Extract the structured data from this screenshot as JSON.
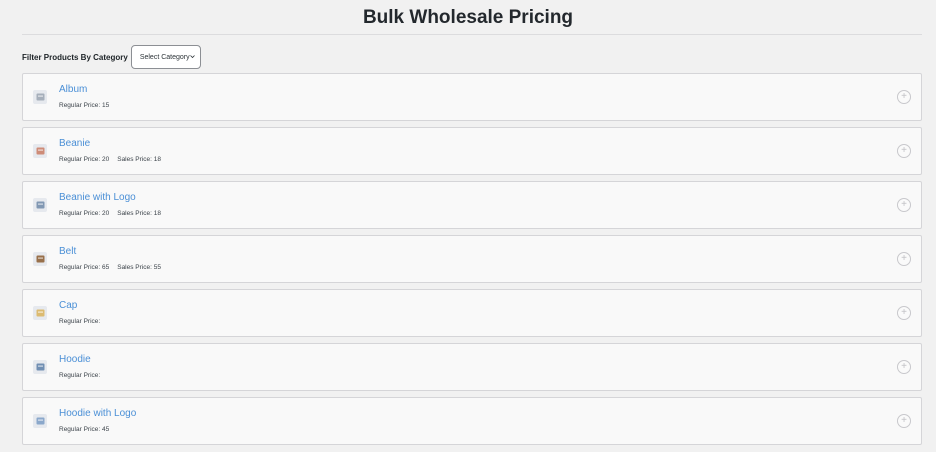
{
  "header": {
    "title": "Bulk Wholesale Pricing"
  },
  "filter": {
    "label": "Filter Products By Category",
    "select_value": "Select Category"
  },
  "products": [
    {
      "name": "Album",
      "regular_label": "Regular Price: 15",
      "sale_label": "",
      "icon": "album-thumbnail",
      "color": "#9aa5b1"
    },
    {
      "name": "Beanie",
      "regular_label": "Regular Price: 20",
      "sale_label": "Sales Price: 18",
      "icon": "beanie-thumbnail",
      "color": "#c97b63"
    },
    {
      "name": "Beanie with Logo",
      "regular_label": "Regular Price: 20",
      "sale_label": "Sales Price: 18",
      "icon": "beanie-logo-thumbnail",
      "color": "#6f89a8"
    },
    {
      "name": "Belt",
      "regular_label": "Regular Price: 65",
      "sale_label": "Sales Price: 55",
      "icon": "belt-thumbnail",
      "color": "#8a5a2e"
    },
    {
      "name": "Cap",
      "regular_label": "Regular Price:",
      "sale_label": "",
      "icon": "cap-thumbnail",
      "color": "#d9b35a"
    },
    {
      "name": "Hoodie",
      "regular_label": "Regular Price:",
      "sale_label": "",
      "icon": "hoodie-thumbnail",
      "color": "#5c7fa8"
    },
    {
      "name": "Hoodie with Logo",
      "regular_label": "Regular Price: 45",
      "sale_label": "",
      "icon": "hoodie-logo-thumbnail",
      "color": "#7a9cc4"
    }
  ],
  "add_icon": "plus-circle-icon"
}
